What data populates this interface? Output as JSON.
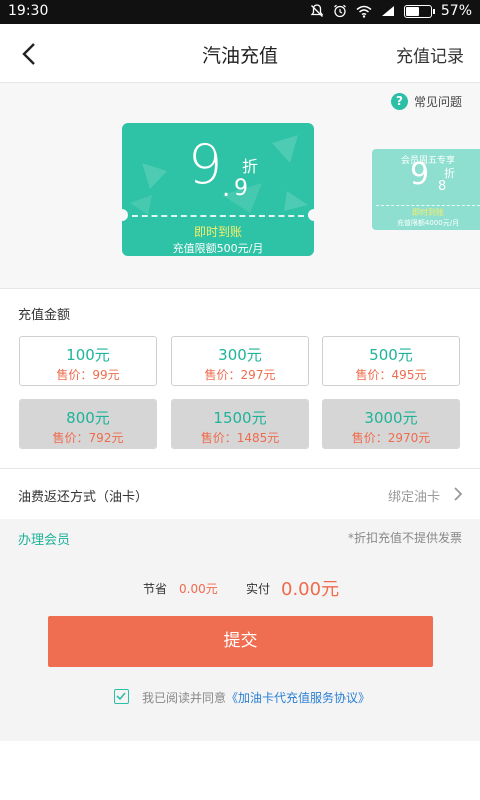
{
  "status_bar": {
    "time": "19:30",
    "battery": "57%",
    "battery_level": 0.57
  },
  "header": {
    "title": "汽油充值",
    "records_label": "充值记录"
  },
  "faq": {
    "icon_text": "?",
    "label": "常见问题"
  },
  "discount_cards": [
    {
      "discount_int": "9",
      "discount_dec": "9",
      "unit": "折",
      "instant": "即时到账",
      "limit": "充值限额500元/月"
    },
    {
      "badge": "会员周五专享",
      "discount_int": "9",
      "discount_dec": "8",
      "unit": "折",
      "instant": "即时到账",
      "limit": "充值限额4000元/月"
    }
  ],
  "amounts": {
    "title": "充值金额",
    "options": [
      {
        "amount": "100元",
        "price": "售价：99元",
        "enabled": true
      },
      {
        "amount": "300元",
        "price": "售价：297元",
        "enabled": true
      },
      {
        "amount": "500元",
        "price": "售价：495元",
        "enabled": true
      },
      {
        "amount": "800元",
        "price": "售价：792元",
        "enabled": false
      },
      {
        "amount": "1500元",
        "price": "售价：1485元",
        "enabled": false
      },
      {
        "amount": "3000元",
        "price": "售价：2970元",
        "enabled": false
      }
    ]
  },
  "refund": {
    "label": "油费返还方式（油卡）",
    "value": "绑定油卡"
  },
  "member": {
    "label": "办理会员",
    "note": "*折扣充值不提供发票"
  },
  "summary": {
    "save_label": "节省",
    "save_value": "0.00元",
    "pay_label": "实付",
    "pay_value": "0.00元"
  },
  "submit_label": "提交",
  "agreement": {
    "checked": true,
    "text": "我已阅读并同意",
    "link": "《加油卡代充值服务协议》"
  },
  "colors": {
    "accent": "#2ec2a6",
    "price": "#ef6b4d",
    "submit": "#ef6d51",
    "link": "#2a7fd4"
  }
}
